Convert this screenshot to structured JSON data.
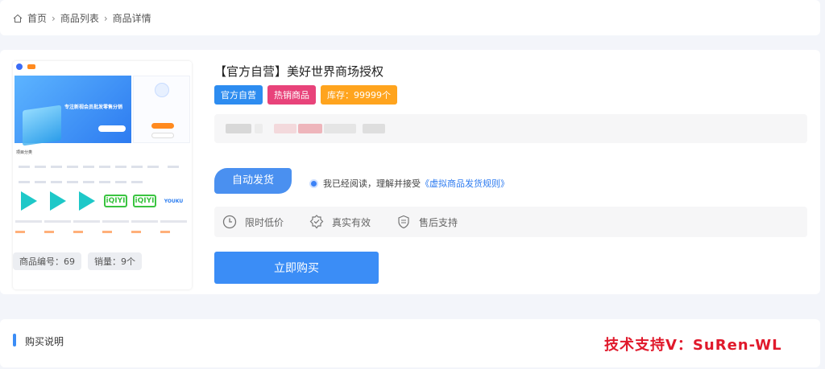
{
  "breadcrumb": {
    "home": "首页",
    "list": "商品列表",
    "detail": "商品详情"
  },
  "product": {
    "title": "【官方自营】美好世界商场授权",
    "badges": {
      "official": "官方自营",
      "hot": "热销商品",
      "stock": "库存：99999个"
    },
    "code": "商品编号：69",
    "sales": "销量：9个"
  },
  "shipping": {
    "auto_label": "自动发货",
    "agree_text": "我已经阅读，理解并接受",
    "agree_link": "《虚拟商品发货规则》"
  },
  "features": {
    "limited": "限时低价",
    "authentic": "真实有效",
    "after_sale": "售后支持"
  },
  "buy_button": "立即购买",
  "purchase_section": {
    "title": "购买说明"
  },
  "watermark": "技术支持V：SuRen-WL",
  "thumbnail": {
    "banner_text": "专注新视会员批发零售分销",
    "category_label": "项目分类",
    "youku": "YOUKU",
    "iqiyi": "iQIYI"
  },
  "colors": {
    "accent": "#3b8df6",
    "hot": "#e8437a",
    "stock": "#ffa41e",
    "watermark": "#e0192b"
  }
}
